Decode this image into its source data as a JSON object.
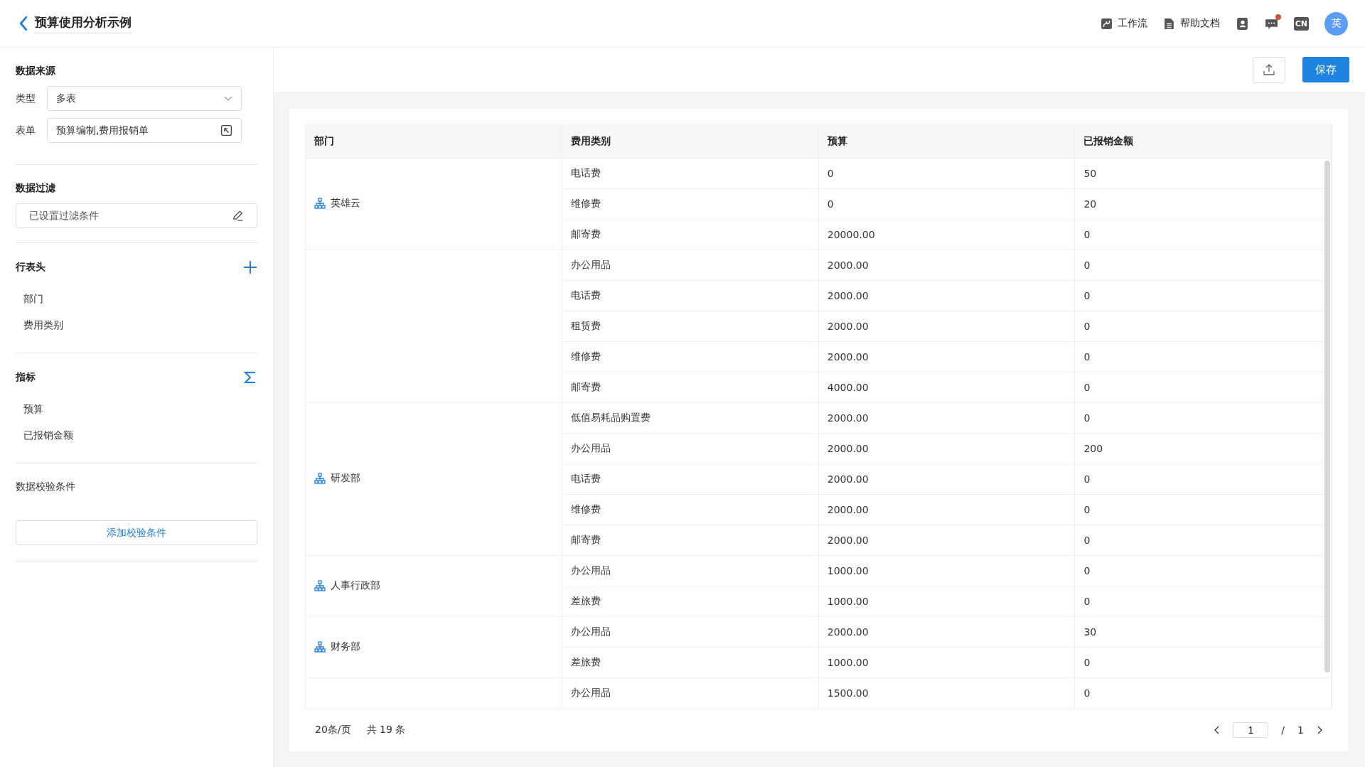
{
  "header": {
    "title": "预算使用分析示例",
    "links": [
      {
        "kind": "workflow",
        "label": "工作流"
      },
      {
        "kind": "help",
        "label": "帮助文档"
      }
    ],
    "notification_badge": true,
    "language": "CN",
    "avatar": "英"
  },
  "sidebar": {
    "source": {
      "title": "数据来源",
      "type_label": "类型",
      "type_value": "多表",
      "form_label": "表单",
      "form_value": "预算编制,费用报销单"
    },
    "filter": {
      "title": "数据过滤",
      "value": "已设置过滤条件"
    },
    "row_headers": {
      "title": "行表头",
      "items": [
        "部门",
        "费用类别"
      ]
    },
    "metrics": {
      "title": "指标",
      "items": [
        "预算",
        "已报销金额"
      ]
    },
    "validation": {
      "title": "数据校验条件",
      "button": "添加校验条件"
    }
  },
  "toolbar": {
    "save": "保存"
  },
  "table": {
    "columns": [
      "部门",
      "费用类别",
      "预算",
      "已报销金额"
    ],
    "groups": [
      {
        "department": "英雄云",
        "rows": [
          [
            "电话费",
            "0",
            "50"
          ],
          [
            "维修费",
            "0",
            "20"
          ],
          [
            "邮寄费",
            "20000.00",
            "0"
          ]
        ]
      },
      {
        "rows": [
          [
            "办公用品",
            "2000.00",
            "0"
          ],
          [
            "电话费",
            "2000.00",
            "0"
          ],
          [
            "租赁费",
            "2000.00",
            "0"
          ],
          [
            "维修费",
            "2000.00",
            "0"
          ],
          [
            "邮寄费",
            "4000.00",
            "0"
          ]
        ]
      },
      {
        "department": "研发部",
        "rows": [
          [
            "低值易耗品购置费",
            "2000.00",
            "0"
          ],
          [
            "办公用品",
            "2000.00",
            "200"
          ],
          [
            "电话费",
            "2000.00",
            "0"
          ],
          [
            "维修费",
            "2000.00",
            "0"
          ],
          [
            "邮寄费",
            "2000.00",
            "0"
          ]
        ]
      },
      {
        "department": "人事行政部",
        "rows": [
          [
            "办公用品",
            "1000.00",
            "0"
          ],
          [
            "差旅费",
            "1000.00",
            "0"
          ]
        ]
      },
      {
        "department": "财务部",
        "rows": [
          [
            "办公用品",
            "2000.00",
            "30"
          ],
          [
            "差旅费",
            "1000.00",
            "0"
          ]
        ]
      },
      {
        "rows": [
          [
            "办公用品",
            "1500.00",
            "0"
          ]
        ]
      }
    ]
  },
  "pagination": {
    "page_size": "20条/页",
    "total": "共 19 条",
    "page": "1",
    "separator": "/",
    "pages": "1"
  }
}
